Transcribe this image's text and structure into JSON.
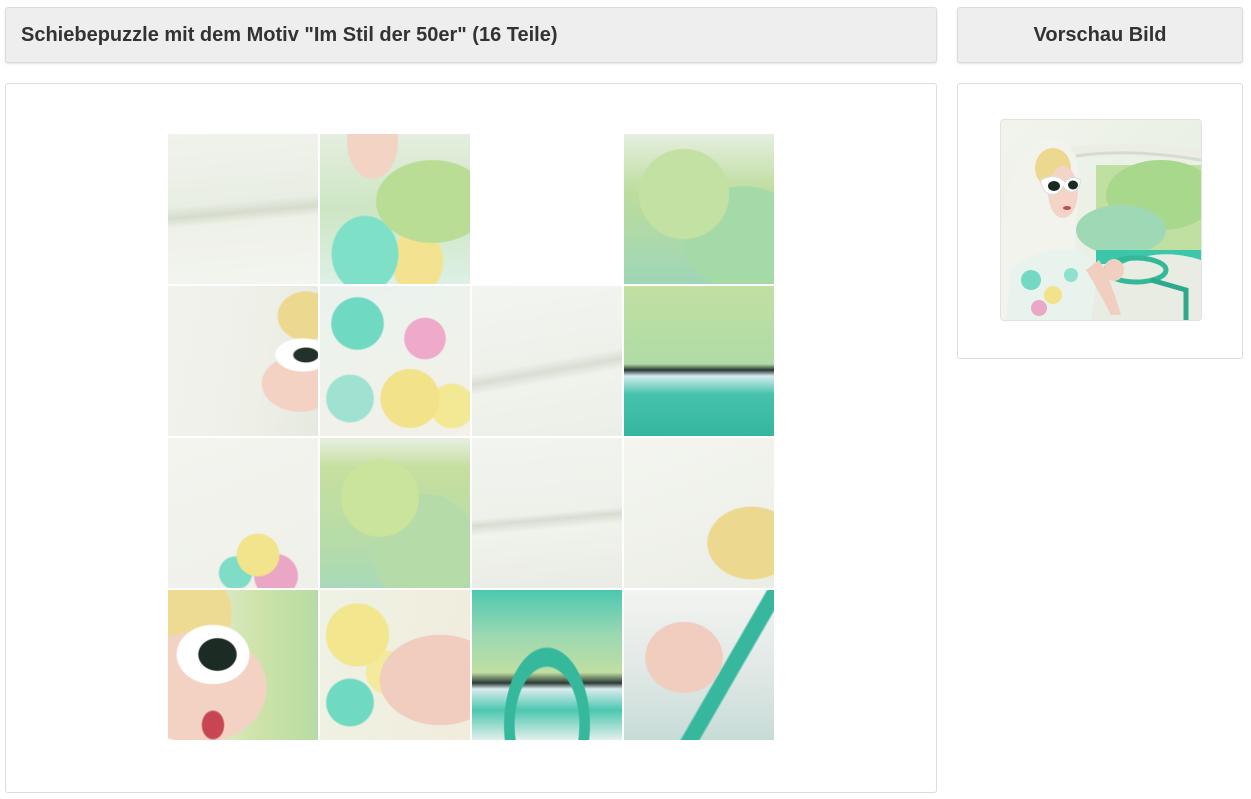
{
  "header": {
    "title": "Schiebepuzzle mit dem Motiv \"Im Stil der 50er\" (16 Teile)",
    "preview_title": "Vorschau Bild"
  },
  "puzzle": {
    "rows": 4,
    "cols": 4,
    "motif": "Im Stil der 50er",
    "piece_count": 16,
    "empty_tile_index": 2,
    "tiles": [
      {
        "label": "tile-1",
        "empty": false,
        "scene": "windshield-hair-edge"
      },
      {
        "label": "tile-2",
        "empty": false,
        "scene": "chin-shoulder-green"
      },
      {
        "label": "tile-3",
        "empty": true,
        "scene": "empty-slot"
      },
      {
        "label": "tile-4",
        "empty": false,
        "scene": "green-trees"
      },
      {
        "label": "tile-5",
        "empty": false,
        "scene": "scarf-sunglasses-edge"
      },
      {
        "label": "tile-6",
        "empty": false,
        "scene": "floral-dress"
      },
      {
        "label": "tile-7",
        "empty": false,
        "scene": "white-door-panel"
      },
      {
        "label": "tile-8",
        "empty": false,
        "scene": "trees-turquoise-dash"
      },
      {
        "label": "tile-9",
        "empty": false,
        "scene": "scarf-floral"
      },
      {
        "label": "tile-10",
        "empty": false,
        "scene": "blurred-greenery"
      },
      {
        "label": "tile-11",
        "empty": false,
        "scene": "white-panel-lines"
      },
      {
        "label": "tile-12",
        "empty": false,
        "scene": "scarf-blonde-hair"
      },
      {
        "label": "tile-13",
        "empty": false,
        "scene": "face-cat-eye-glasses"
      },
      {
        "label": "tile-14",
        "empty": false,
        "scene": "yellow-dress-arm"
      },
      {
        "label": "tile-15",
        "empty": false,
        "scene": "turquoise-steering-wheel"
      },
      {
        "label": "tile-16",
        "empty": false,
        "scene": "hand-on-wheel"
      }
    ]
  },
  "preview": {
    "alt": "Vorschau Bild"
  },
  "colors": {
    "header_bg": "#eeeeee",
    "header_text": "#333333",
    "panel_border": "#dddddd",
    "turquoise": "#3cc7aa",
    "foliage": "#b8d98a",
    "cream": "#eef1e6",
    "skin": "#f1cfc0",
    "hair": "#ecd98f"
  }
}
